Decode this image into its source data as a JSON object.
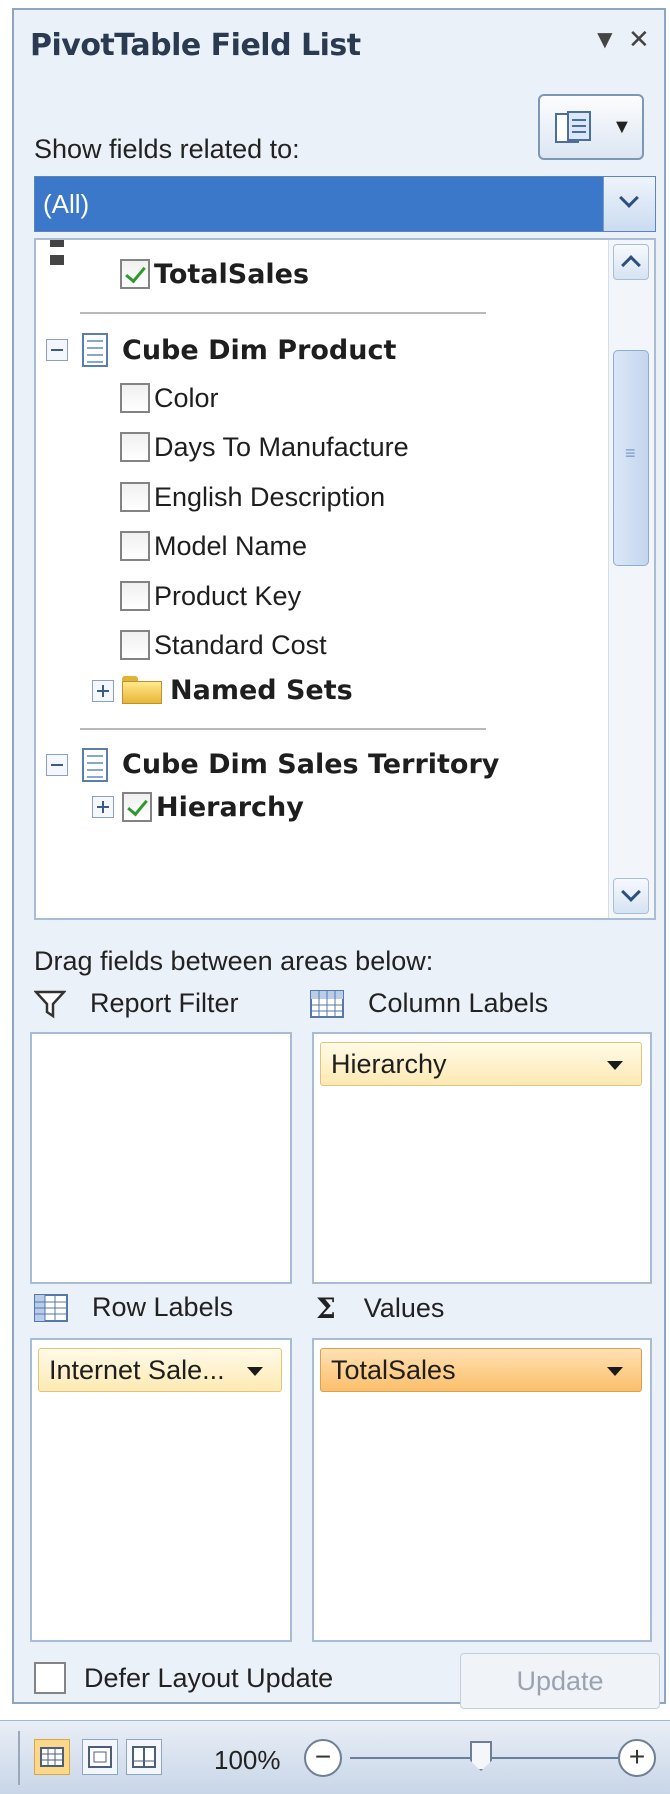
{
  "window": {
    "title": "PivotTable Field List",
    "menu_glyph": "▼",
    "close_glyph": "✕"
  },
  "header": {
    "show_fields_label": "Show fields related to:",
    "combo_value": "(All)"
  },
  "field_list": {
    "measure_item": {
      "label": "TotalSales",
      "checked": true
    },
    "groups": [
      {
        "label": "Cube Dim Product",
        "expanded": true,
        "fields": [
          {
            "label": "Color",
            "checked": false
          },
          {
            "label": "Days To Manufacture",
            "checked": false
          },
          {
            "label": "English Description",
            "checked": false
          },
          {
            "label": "Model Name",
            "checked": false
          },
          {
            "label": "Product Key",
            "checked": false
          },
          {
            "label": "Standard Cost",
            "checked": false
          }
        ],
        "named_sets_label": "Named Sets"
      },
      {
        "label": "Cube Dim Sales Territory",
        "expanded": true,
        "fields": [
          {
            "label": "Hierarchy",
            "checked": true
          }
        ]
      }
    ]
  },
  "areas": {
    "instruction": "Drag fields between areas below:",
    "report_filter": {
      "label": "Report Filter",
      "items": []
    },
    "column_labels": {
      "label": "Column Labels",
      "items": [
        "Hierarchy"
      ]
    },
    "row_labels": {
      "label": "Row Labels",
      "items": [
        "Internet Sale..."
      ]
    },
    "values": {
      "label": "Values",
      "symbol": "Σ",
      "items": [
        "TotalSales"
      ]
    }
  },
  "footer": {
    "defer_label": "Defer Layout Update",
    "defer_checked": false,
    "update_button": "Update"
  },
  "statusbar": {
    "zoom_text": "100%",
    "zoom_out_glyph": "−",
    "zoom_in_glyph": "+"
  },
  "colors": {
    "selected_combo": "#3c78c9",
    "check_green": "#2f9a2f",
    "pill_active": "#fbbf6b"
  }
}
